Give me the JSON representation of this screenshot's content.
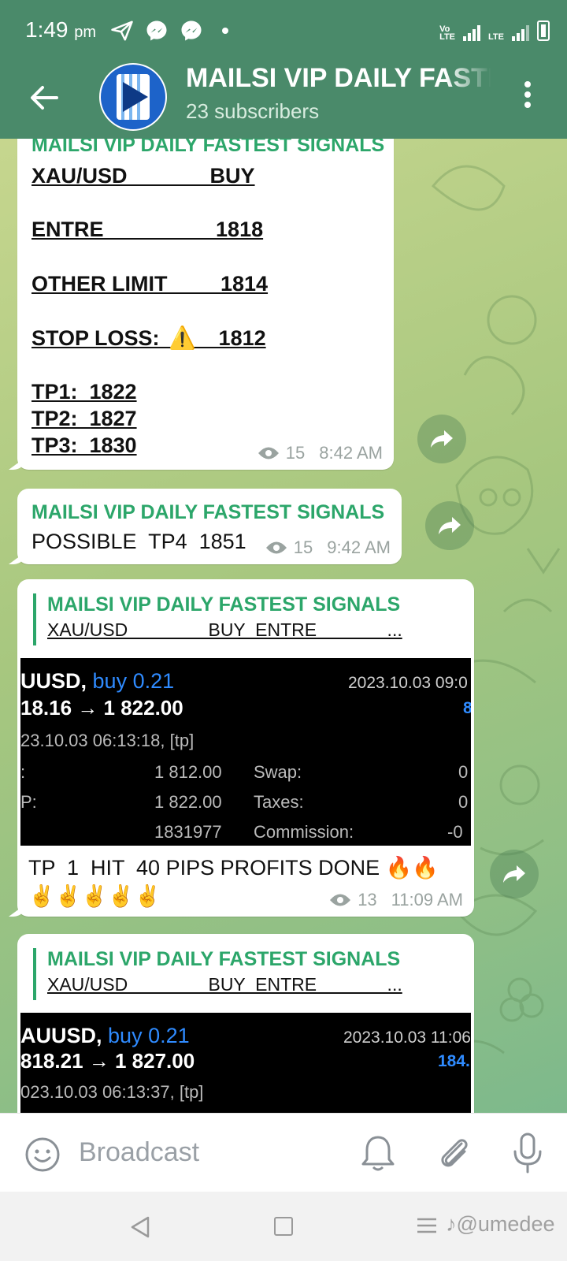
{
  "status_bar": {
    "time": "1:49",
    "ampm": "pm",
    "icons": [
      "telegram-send-icon",
      "messenger-icon",
      "messenger-icon",
      "dot-icon"
    ],
    "network_label": "LTE",
    "network_label_2": "LTE"
  },
  "header": {
    "title": "MAILSI VIP DAILY FASTEST SIGNALS",
    "subtitle": "23 subscribers"
  },
  "messages": [
    {
      "sender": "MAILSI VIP DAILY FASTEST SIGNALS",
      "lines": [
        "XAU/USD              BUY",
        "ENTRE                   1818",
        "OTHER LIMIT         1814",
        "STOP LOSS:          1812",
        "TP1:  1822",
        "TP2:  1827",
        "TP3:  1830"
      ],
      "warning_emoji": "⚠️",
      "views": "15",
      "time": "8:42 AM"
    },
    {
      "sender": "MAILSI VIP DAILY FASTEST SIGNALS",
      "text": "POSSIBLE  TP4  1851",
      "views": "15",
      "time": "9:42 AM"
    },
    {
      "reply_sender": "MAILSI VIP DAILY FASTEST SIGNALS",
      "reply_text": "XAU/USD                BUY  ENTRE              ...",
      "shot": {
        "symbol": "UUSD,",
        "trade": "buy 0.21",
        "date": "2023.10.03 09:0",
        "price": "18.16 → 1 822.00",
        "profit": "8",
        "open_time": "23.10.03 06:13:18, [tp]",
        "sl_label": ":",
        "sl_value": "1 812.00",
        "swap_label": "Swap:",
        "swap_value": "0",
        "tp_label": "P:",
        "tp_value": "1 822.00",
        "taxes_label": "Taxes:",
        "taxes_value": "0",
        "id_value": "1831977",
        "commission_label": "Commission:",
        "commission_value": "-0"
      },
      "text": "TP  1  HIT  40 PIPS PROFITS DONE 🔥🔥",
      "emoji_line": "✌️✌️✌️✌️✌️",
      "views": "13",
      "time": "11:09 AM"
    },
    {
      "reply_sender": "MAILSI VIP DAILY FASTEST SIGNALS",
      "reply_text": "XAU/USD                BUY  ENTRE              ...",
      "shot": {
        "symbol": "AUUSD,",
        "trade": "buy 0.21",
        "date": "2023.10.03 11:06:",
        "price": "818.21 → 1 827.00",
        "profit": "184.",
        "open_time": "023.10.03 06:13:37, [tp]"
      }
    }
  ],
  "input": {
    "placeholder": "Broadcast"
  },
  "watermark": "@umedee",
  "colors": {
    "header": "#4a8a6a",
    "accent": "#2ca66a",
    "blue_trade": "#2f8bff"
  }
}
